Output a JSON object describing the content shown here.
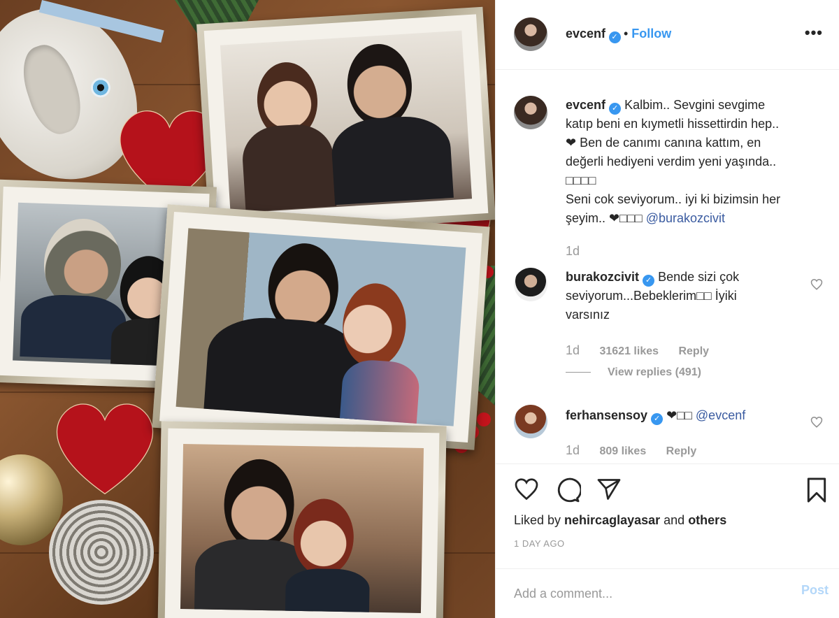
{
  "post": {
    "author": "evcenf",
    "follow_label": "Follow",
    "more_icon": "more-options-icon"
  },
  "caption": {
    "username": "evcenf",
    "line1": "Kalbim.. Sevgini sevgime",
    "line2": "katıp beni en kıymetli hissettirdin hep..",
    "line3": "❤ Ben de canımı canına kattım, en",
    "line4": "değerli hediyeni verdim yeni yaşında..",
    "line5": "□□□□",
    "line6": "Seni cok seviyorum.. iyi ki bizimsin her",
    "line7_text": "şeyim.. ❤□□□ ",
    "line7_mention": "@burakozcivit",
    "time": "1d"
  },
  "comments": [
    {
      "username": "burakozcivit",
      "line1": "Bende sizi çok",
      "line2": "seviyorum...Bebeklerim□□ İyiki",
      "line3": "varsınız",
      "time": "1d",
      "likes": "31621 likes",
      "reply": "Reply",
      "view_replies": "View replies (491)"
    },
    {
      "username": "ferhansensoy",
      "text": "❤□□ ",
      "mention": "@evcenf",
      "time": "1d",
      "likes": "809 likes",
      "reply": "Reply"
    }
  ],
  "liked_by": {
    "prefix": "Liked by ",
    "user": "nehircaglayasar",
    "middle": " and ",
    "others": "others"
  },
  "timestamp": "1 DAY AGO",
  "add_comment": {
    "placeholder": "Add a comment...",
    "post_label": "Post"
  },
  "colors": {
    "accent": "#3897f0",
    "mention": "#3a5ba0",
    "muted": "#999999",
    "post_disabled": "#b3d7f9"
  }
}
